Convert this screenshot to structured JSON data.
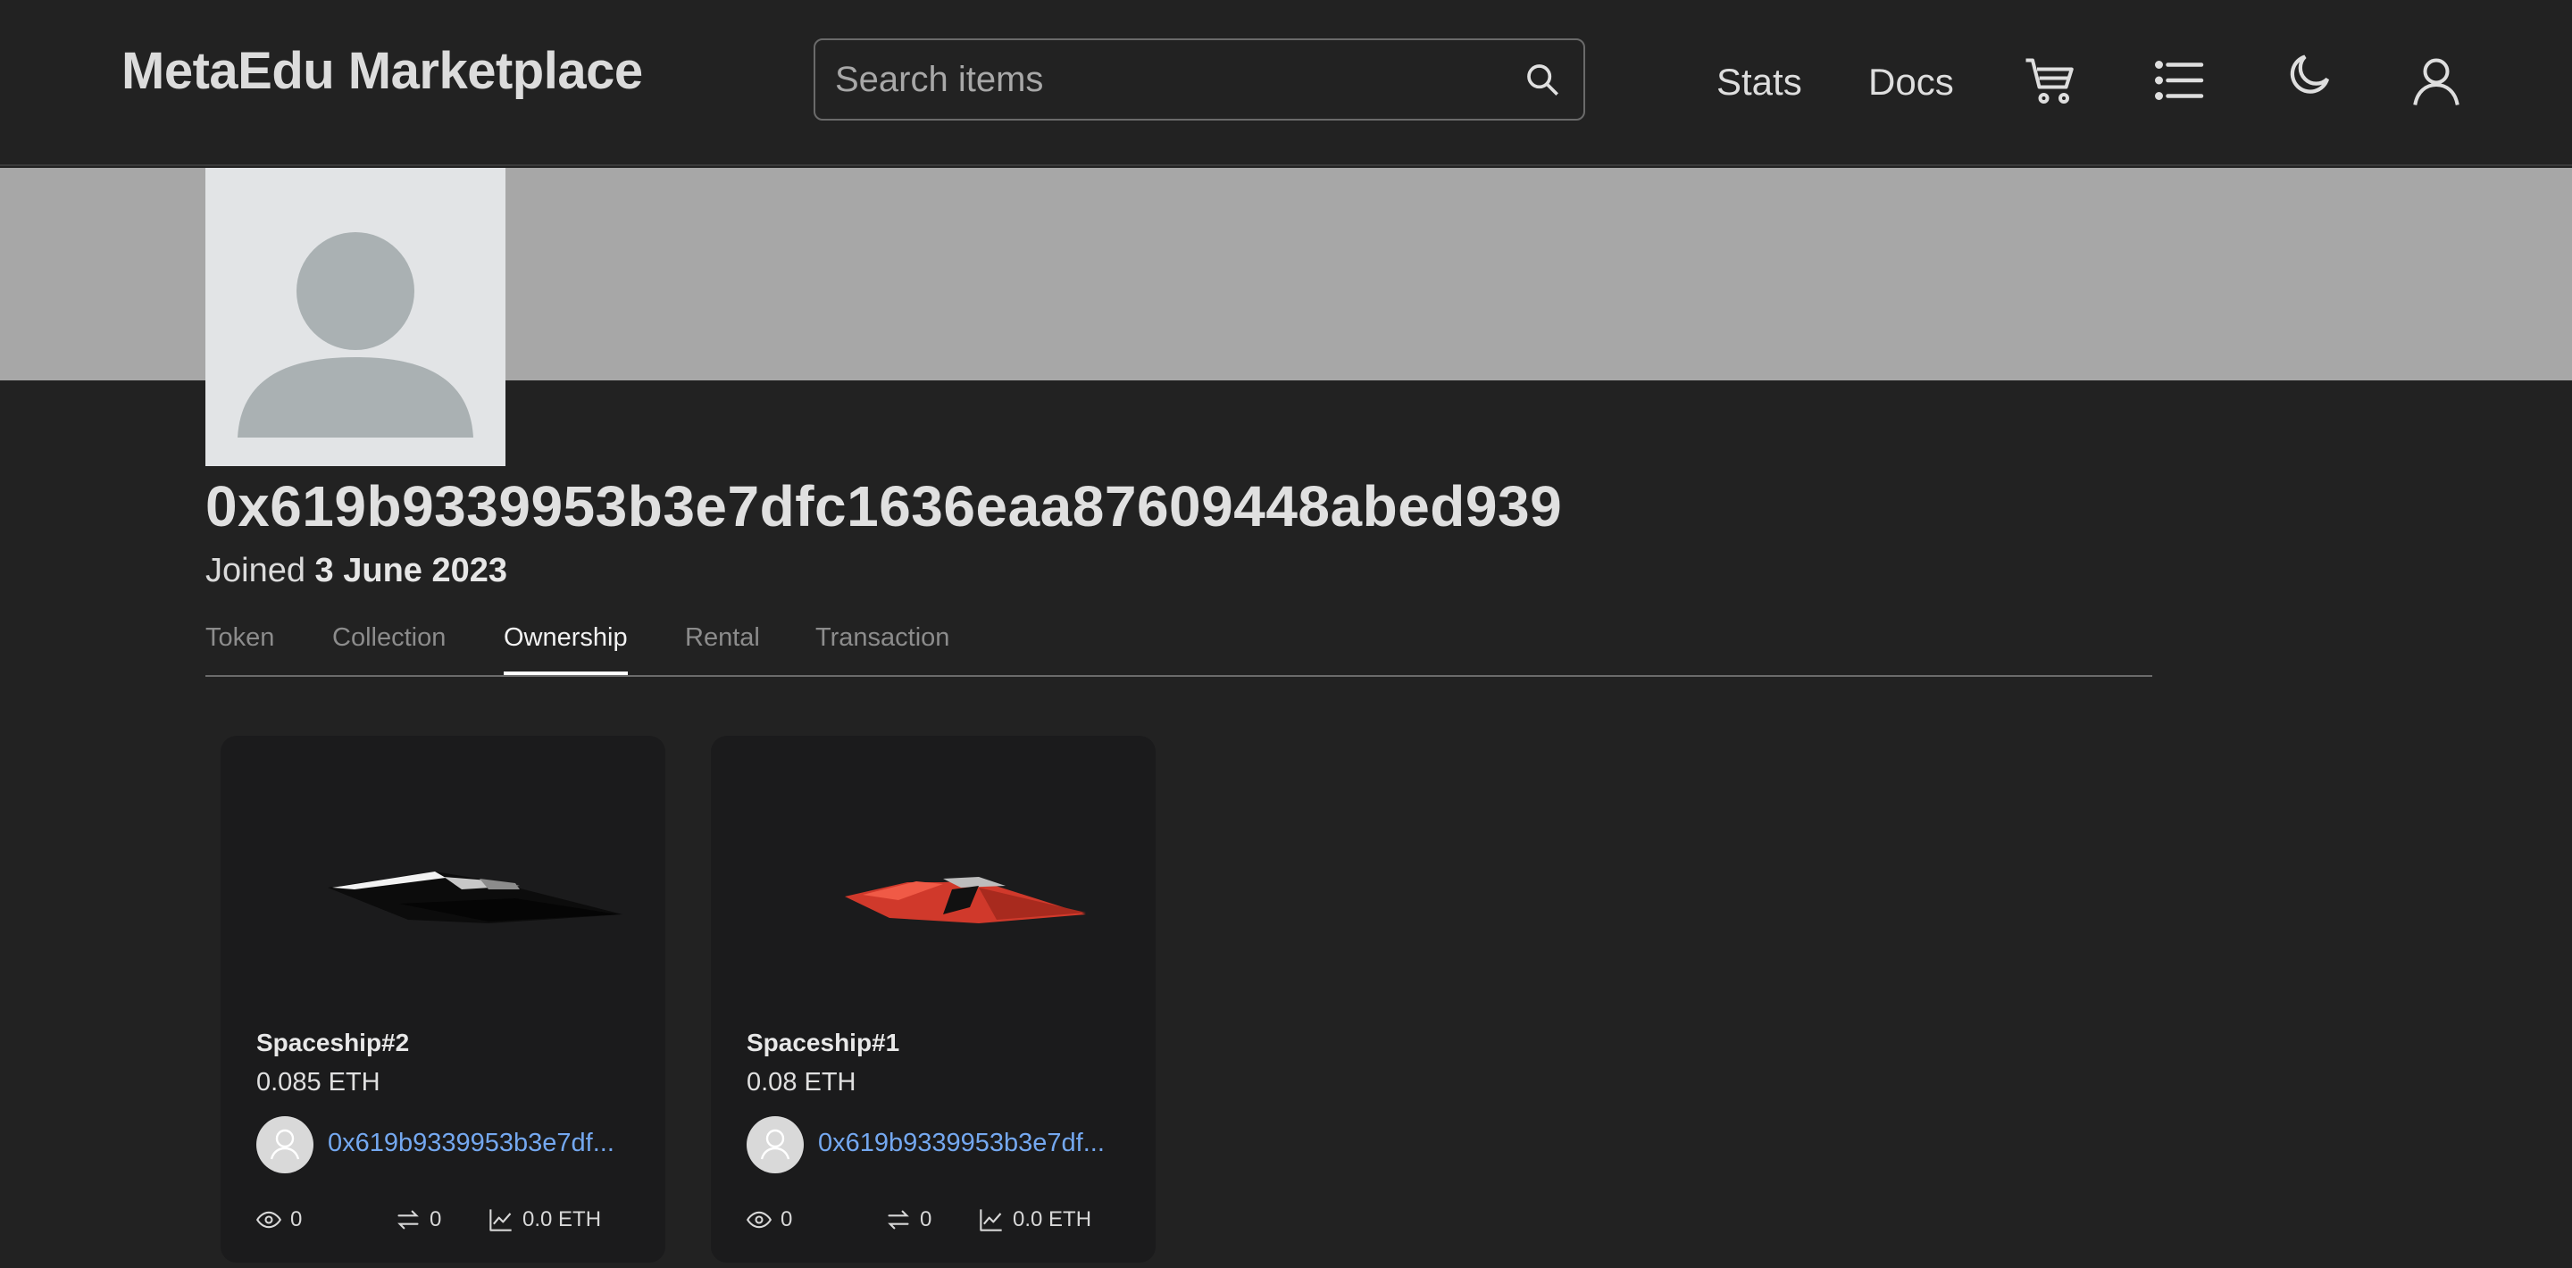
{
  "header": {
    "brand": "MetaEdu Marketplace",
    "search_placeholder": "Search items",
    "nav": {
      "stats": "Stats",
      "docs": "Docs"
    }
  },
  "profile": {
    "address": "0x619b9339953b3e7dfc1636eaa87609448abed939",
    "joined_prefix": "Joined",
    "joined_date": "3 June 2023"
  },
  "tabs": [
    {
      "label": "Token",
      "active": false
    },
    {
      "label": "Collection",
      "active": false
    },
    {
      "label": "Ownership",
      "active": true
    },
    {
      "label": "Rental",
      "active": false
    },
    {
      "label": "Transaction",
      "active": false
    }
  ],
  "cards": [
    {
      "name": "Spaceship#2",
      "price": "0.085 ETH",
      "owner": "0x619b9339953b3e7df...",
      "views": "0",
      "transfers": "0",
      "volume": "0.0 ETH",
      "ship_color": "#0c0c0c"
    },
    {
      "name": "Spaceship#1",
      "price": "0.08 ETH",
      "owner": "0x619b9339953b3e7df...",
      "views": "0",
      "transfers": "0",
      "volume": "0.0 ETH",
      "ship_color": "#d0392b"
    }
  ],
  "icons": {
    "search": "search-icon",
    "cart": "cart-icon",
    "list": "list-icon",
    "theme": "moon-icon",
    "account": "user-icon",
    "views": "eye-icon",
    "transfers": "transfer-icon",
    "volume": "chart-icon"
  }
}
